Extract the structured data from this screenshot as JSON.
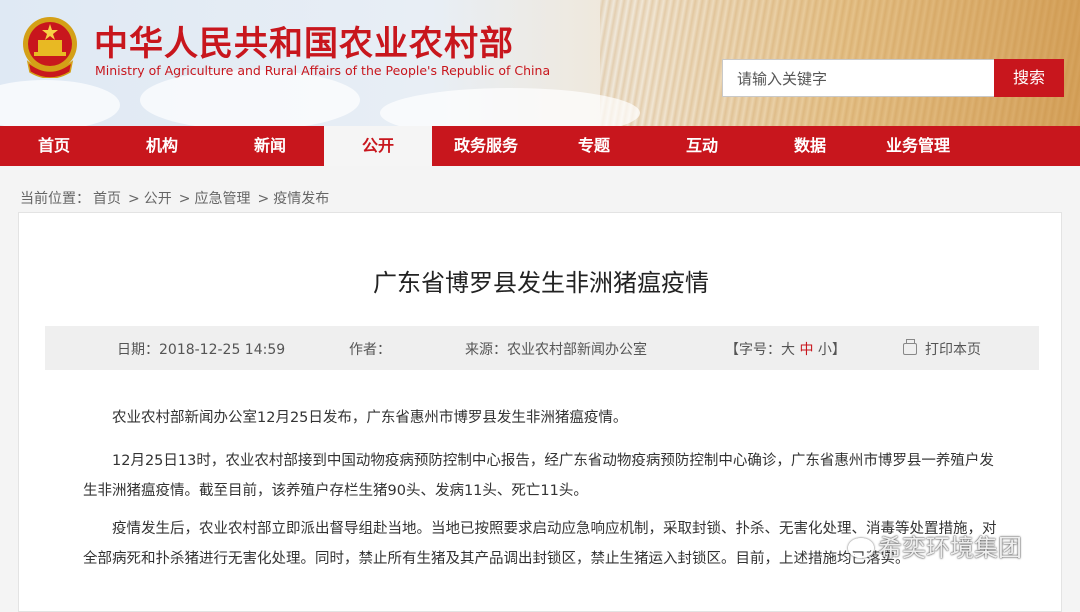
{
  "header": {
    "title_cn": "中华人民共和国农业农村部",
    "title_en": "Ministry of Agriculture and Rural Affairs of the People's Republic of China",
    "search_placeholder": "请输入关键字",
    "search_button": "搜索"
  },
  "nav": {
    "items": [
      "首页",
      "机构",
      "新闻",
      "公开",
      "政务服务",
      "专题",
      "互动",
      "数据",
      "业务管理"
    ],
    "active_index": 3
  },
  "breadcrumb": {
    "label": "当前位置：",
    "items": [
      "首页",
      "公开",
      "应急管理",
      "疫情发布"
    ],
    "separator": ">"
  },
  "article": {
    "title": "广东省博罗县发生非洲猪瘟疫情",
    "meta": {
      "date": "日期：2018-12-25 14:59",
      "author": "作者：",
      "source": "来源：农业农村部新闻办公室",
      "font_size_label": "【字号：",
      "font_large": "大",
      "font_medium": "中",
      "font_small": "小】",
      "print": "打印本页"
    },
    "paragraphs": [
      "农业农村部新闻办公室12月25日发布，广东省惠州市博罗县发生非洲猪瘟疫情。",
      "12月25日13时，农业农村部接到中国动物疫病预防控制中心报告，经广东省动物疫病预防控制中心确诊，广东省惠州市博罗县一养殖户发生非洲猪瘟疫情。截至目前，该养殖户存栏生猪90头、发病11头、死亡11头。",
      "疫情发生后，农业农村部立即派出督导组赴当地。当地已按照要求启动应急响应机制，采取封锁、扑杀、无害化处理、消毒等处置措施，对全部病死和扑杀猪进行无害化处理。同时，禁止所有生猪及其产品调出封锁区，禁止生猪运入封锁区。目前，上述措施均已落实。"
    ]
  },
  "watermark": "希奕环境集团",
  "colors": {
    "brand_red": "#c8161d"
  }
}
